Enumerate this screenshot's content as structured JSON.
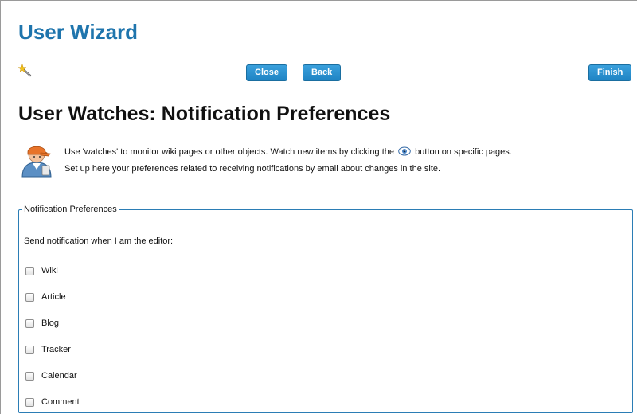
{
  "wizard": {
    "title": "User Wizard",
    "close_label": "Close",
    "back_label": "Back",
    "finish_label": "Finish"
  },
  "page": {
    "title": "User Watches: Notification Preferences",
    "intro_before_icon": "Use 'watches' to monitor wiki pages or other objects. Watch new items by clicking the",
    "intro_after_icon": "button on specific pages.",
    "intro_line2": "Set up here your preferences related to receiving notifications by email about changes in the site."
  },
  "preferences": {
    "legend": "Notification Preferences",
    "send_label": "Send notification when I am the editor:",
    "options": [
      {
        "label": "Wiki",
        "checked": false
      },
      {
        "label": "Article",
        "checked": false
      },
      {
        "label": "Blog",
        "checked": false
      },
      {
        "label": "Tracker",
        "checked": false
      },
      {
        "label": "Calendar",
        "checked": false
      },
      {
        "label": "Comment",
        "checked": false
      }
    ]
  },
  "icons": {
    "wand": "wand-icon",
    "avatar": "user-avatar-icon",
    "eye": "eye-icon"
  },
  "colors": {
    "title_blue": "#1f75ad",
    "button_blue": "#2490d0",
    "fieldset_border": "#2b7db5"
  }
}
